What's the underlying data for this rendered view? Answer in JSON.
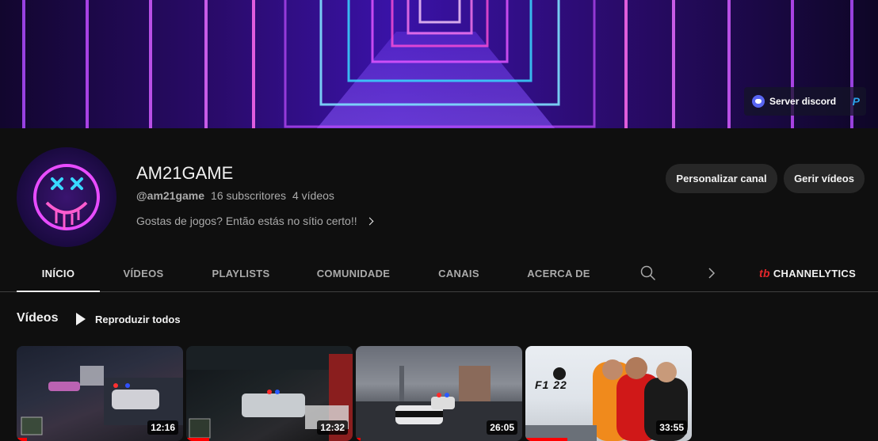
{
  "banner": {
    "link_label": "Server discord"
  },
  "channel": {
    "name": "AM21GAME",
    "handle": "@am21game",
    "subscribers": "16 subscritores",
    "videos_count": "4 vídeos",
    "description": "Gostas de jogos? Então estás no sítio certo!!"
  },
  "actions": {
    "customize": "Personalizar canal",
    "manage": "Gerir vídeos"
  },
  "tabs": [
    {
      "label": "INÍCIO",
      "active": true
    },
    {
      "label": "VÍDEOS"
    },
    {
      "label": "PLAYLISTS"
    },
    {
      "label": "COMUNIDADE"
    },
    {
      "label": "CANAIS"
    },
    {
      "label": "ACERCA DE"
    }
  ],
  "extension": {
    "label": "CHANNELYTICS",
    "icon_text": "tb"
  },
  "section": {
    "title": "Vídeos",
    "play_all": "Reproduzir todos"
  },
  "videos": [
    {
      "duration": "12:16",
      "watched": 0.06
    },
    {
      "duration": "12:32",
      "watched": 0.14
    },
    {
      "duration": "26:05",
      "watched": 0.03
    },
    {
      "duration": "33:55",
      "watched": 0.25,
      "logo_text": "F1 22"
    }
  ],
  "colors": {
    "background": "#0f0f0f",
    "button": "#272727",
    "progress": "#ff0000",
    "channelytics": "#e3262a"
  }
}
